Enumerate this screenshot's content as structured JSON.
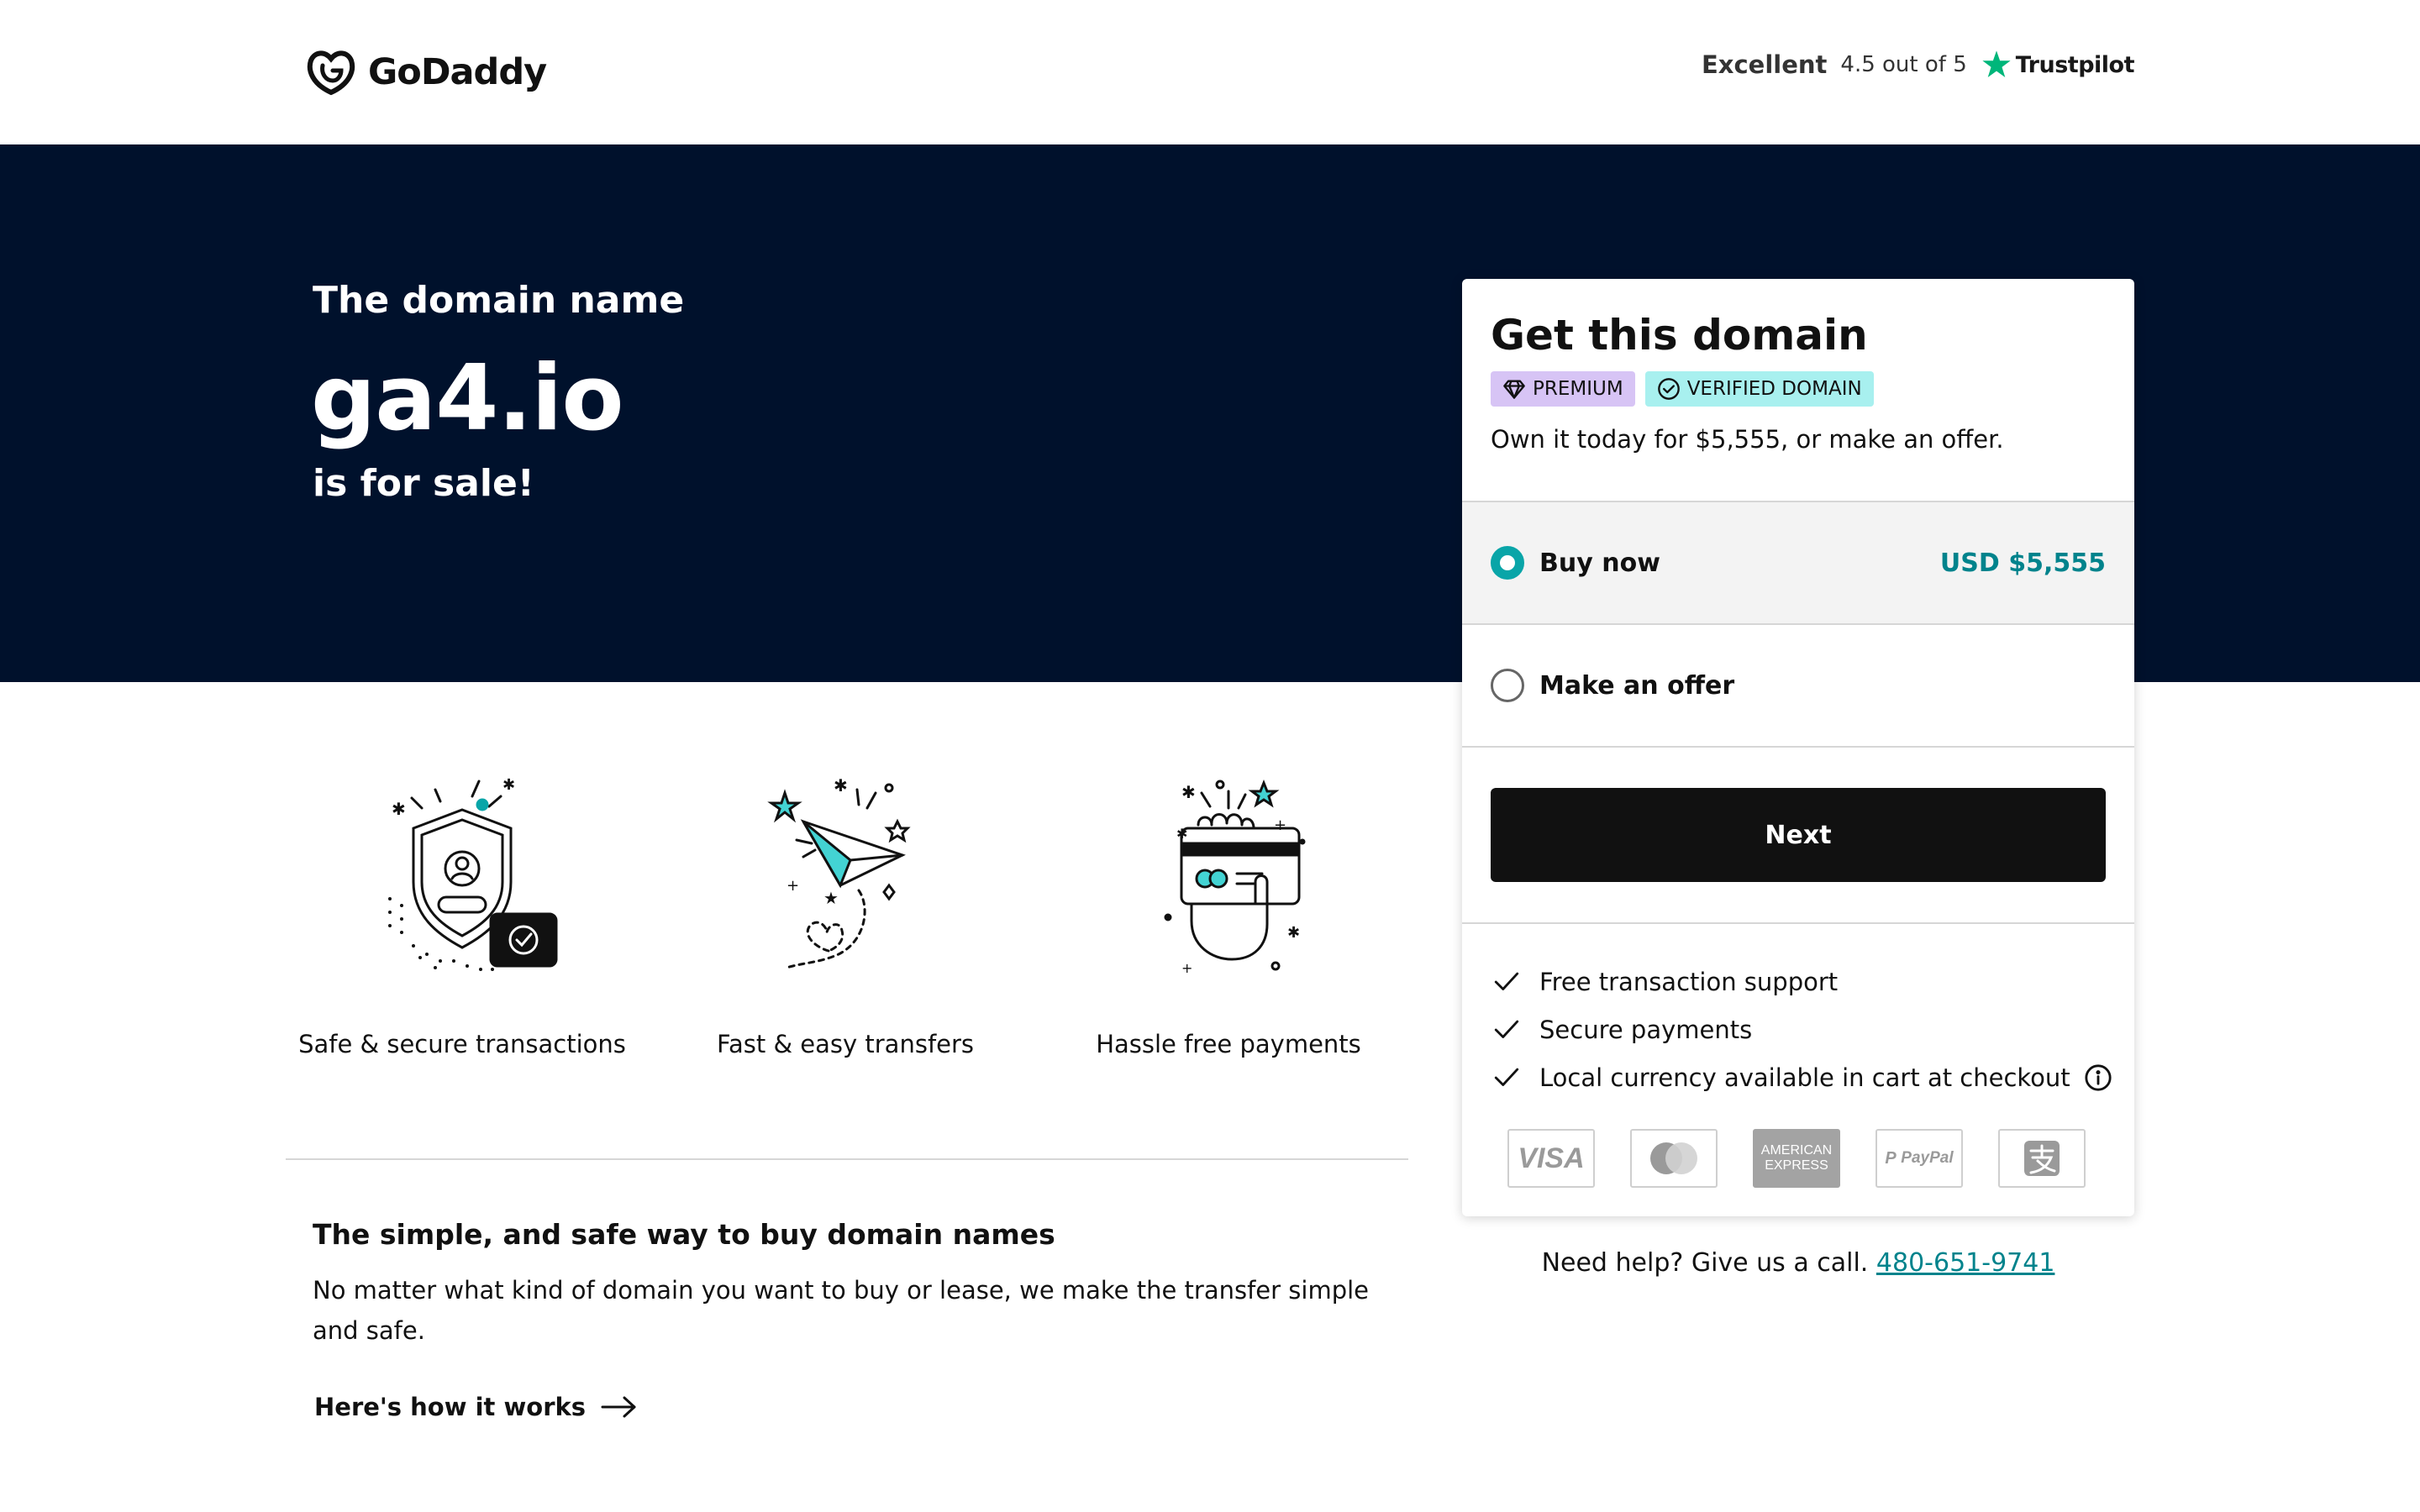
{
  "header": {
    "logo_text": "GoDaddy",
    "trustpilot": {
      "rating_word": "Excellent",
      "score": "4.5 out of 5",
      "brand": "Trustpilot"
    }
  },
  "hero": {
    "pre": "The domain name",
    "domain": "ga4.io",
    "post": "is for sale!"
  },
  "features": [
    {
      "label": "Safe & secure transactions",
      "icon": "shield-icon"
    },
    {
      "label": "Fast & easy transfers",
      "icon": "paper-plane-icon"
    },
    {
      "label": "Hassle free payments",
      "icon": "card-hand-icon"
    }
  ],
  "info": {
    "title": "The simple, and safe way to buy domain names",
    "text": "No matter what kind of domain you want to buy or lease, we make the transfer simple and safe.",
    "link": "Here's how it works"
  },
  "card": {
    "title": "Get this domain",
    "badges": {
      "premium": "PREMIUM",
      "verified": "VERIFIED DOMAIN"
    },
    "subtitle": "Own it today for $5,555, or make an offer.",
    "options": {
      "buy_label": "Buy now",
      "buy_price": "USD $5,555",
      "offer_label": "Make an offer"
    },
    "next_label": "Next",
    "checks": [
      "Free transaction support",
      "Secure payments",
      "Local currency available in cart at checkout"
    ],
    "payments": {
      "visa": "VISA",
      "amex_top": "AMERICAN",
      "amex_bottom": "EXPRESS",
      "paypal": "PayPal"
    }
  },
  "help": {
    "text": "Need help? Give us a call.",
    "phone": "480-651-9741"
  },
  "colors": {
    "hero_bg": "#00112c",
    "accent_teal": "#09a5a8",
    "price_teal": "#00838c",
    "premium_badge": "#d7c4f5",
    "verified_badge": "#a8f0ef",
    "button_bg": "#111111"
  }
}
